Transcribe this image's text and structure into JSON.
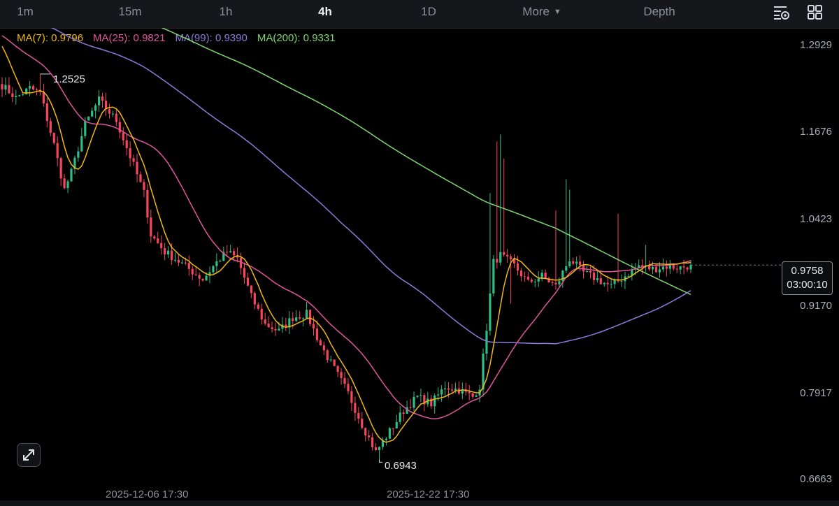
{
  "timeframes": {
    "tabs": [
      "1m",
      "15m",
      "1h",
      "4h",
      "1D"
    ],
    "active": "4h",
    "more_label": "More",
    "depth_label": "Depth"
  },
  "icons": {
    "settings": "chart-settings-icon",
    "layout": "grid-layout-icon",
    "expand": "expand-arrows-icon"
  },
  "ma_legend": {
    "ma7": "MA(7): 0.9796",
    "ma25": "MA(25): 0.9821",
    "ma99": "MA(99): 0.9390",
    "ma200": "MA(200): 0.9331"
  },
  "colors": {
    "up": "#2ebd85",
    "down": "#f6465d",
    "ma7": "#f0b90b",
    "ma25": "#e0569d",
    "ma99": "#8a7bd8",
    "ma200": "#7ed66e"
  },
  "last_price": {
    "price": "0.9758",
    "countdown": "03:00:10"
  },
  "annotations": {
    "high": "1.2525",
    "low": "0.6943"
  },
  "chart_data": {
    "type": "candlestick",
    "timeframe": "4h",
    "y_axis_ticks": [
      1.2929,
      1.1676,
      1.0423,
      0.917,
      0.7917,
      0.6663
    ],
    "y_axis_tick_labels": [
      "1.2929",
      "1.1676",
      "1.0423",
      "0.9170",
      "0.7917",
      "0.6663"
    ],
    "ylim": [
      0.6663,
      1.2929
    ],
    "x_axis_ticks": [
      "2025-12-06 17:30",
      "2025-12-22 17:30"
    ],
    "candle_count": 200,
    "last_price": 0.9758,
    "high": {
      "value": 1.2525,
      "candle_index": 11
    },
    "low": {
      "value": 0.6943,
      "candle_index": 109
    },
    "price_anchors": [
      [
        0,
        1.236
      ],
      [
        4,
        1.218
      ],
      [
        8,
        1.232
      ],
      [
        11,
        1.225
      ],
      [
        15,
        1.15
      ],
      [
        18,
        1.085
      ],
      [
        20,
        1.11
      ],
      [
        24,
        1.18
      ],
      [
        28,
        1.215
      ],
      [
        33,
        1.185
      ],
      [
        38,
        1.12
      ],
      [
        41,
        1.08
      ],
      [
        43,
        1.02
      ],
      [
        47,
        0.995
      ],
      [
        50,
        0.985
      ],
      [
        54,
        0.97
      ],
      [
        58,
        0.955
      ],
      [
        62,
        0.98
      ],
      [
        65,
        0.995
      ],
      [
        68,
        0.985
      ],
      [
        72,
        0.93
      ],
      [
        76,
        0.89
      ],
      [
        80,
        0.88
      ],
      [
        84,
        0.9
      ],
      [
        88,
        0.905
      ],
      [
        92,
        0.86
      ],
      [
        96,
        0.825
      ],
      [
        100,
        0.79
      ],
      [
        104,
        0.745
      ],
      [
        108,
        0.705
      ],
      [
        112,
        0.735
      ],
      [
        116,
        0.765
      ],
      [
        120,
        0.785
      ],
      [
        124,
        0.775
      ],
      [
        128,
        0.8
      ],
      [
        132,
        0.795
      ],
      [
        136,
        0.785
      ],
      [
        138,
        0.8
      ],
      [
        140,
        0.885
      ],
      [
        142,
        0.98
      ],
      [
        144,
        0.99
      ],
      [
        148,
        0.975
      ],
      [
        152,
        0.95
      ],
      [
        156,
        0.96
      ],
      [
        160,
        0.945
      ],
      [
        164,
        0.985
      ],
      [
        168,
        0.965
      ],
      [
        172,
        0.955
      ],
      [
        176,
        0.945
      ],
      [
        180,
        0.96
      ],
      [
        184,
        0.975
      ],
      [
        188,
        0.97
      ],
      [
        192,
        0.974
      ],
      [
        196,
        0.972
      ],
      [
        199,
        0.9758
      ]
    ],
    "ma_series": [
      {
        "name": "MA(7)",
        "last": 0.9796
      },
      {
        "name": "MA(25)",
        "last": 0.9821
      },
      {
        "name": "MA(99)",
        "last": 0.939
      },
      {
        "name": "MA(200)",
        "last": 0.9331
      }
    ],
    "grid": false
  }
}
